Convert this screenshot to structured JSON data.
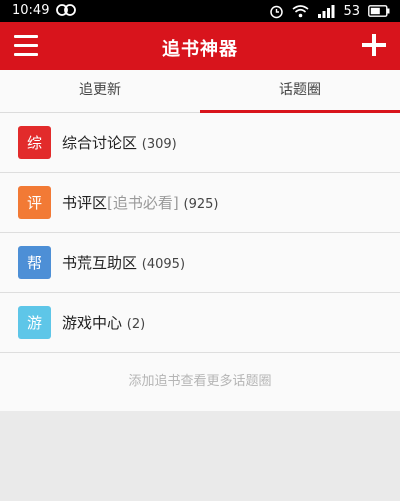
{
  "status": {
    "time": "10:49",
    "battery": "53"
  },
  "appbar": {
    "title": "追书神器"
  },
  "tabs": [
    {
      "label": "追更新"
    },
    {
      "label": "话题圈"
    }
  ],
  "items": [
    {
      "badge": "综",
      "color": "#e22b2b",
      "title": "综合讨论区",
      "subtitle": "",
      "count": "(309)"
    },
    {
      "badge": "评",
      "color": "#f27a35",
      "title": "书评区",
      "subtitle": "[追书必看]",
      "count": "(925)"
    },
    {
      "badge": "帮",
      "color": "#4d8fd6",
      "title": "书荒互助区",
      "subtitle": "",
      "count": "(4095)"
    },
    {
      "badge": "游",
      "color": "#5ec6e8",
      "title": "游戏中心",
      "subtitle": "",
      "count": "(2)"
    }
  ],
  "footer": {
    "link": "添加追书查看更多话题圈"
  }
}
